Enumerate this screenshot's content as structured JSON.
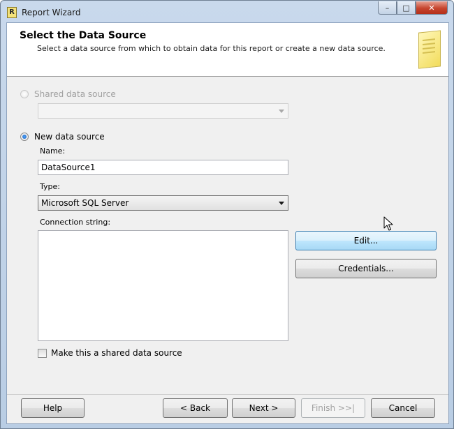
{
  "window": {
    "title": "Report Wizard",
    "app_icon_glyph": "R",
    "controls": {
      "minimize": "–",
      "maximize": "□",
      "close": "✕"
    }
  },
  "header": {
    "title": "Select the Data Source",
    "subtitle": "Select a data source from which to obtain data for this report or create a new data source."
  },
  "shared_source": {
    "label": "Shared data source",
    "selected": false,
    "enabled": false,
    "value": ""
  },
  "new_source": {
    "label": "New data source",
    "selected": true,
    "name_label": "Name:",
    "name_value": "DataSource1",
    "type_label": "Type:",
    "type_value": "Microsoft SQL Server",
    "conn_label": "Connection string:",
    "conn_value": ""
  },
  "actions": {
    "edit_label": "Edit...",
    "credentials_label": "Credentials..."
  },
  "shared_checkbox": {
    "label": "Make this a shared data source",
    "checked": false
  },
  "footer": {
    "help_label": "Help",
    "back_label": "< Back",
    "next_label": "Next >",
    "finish_label": "Finish >>|",
    "cancel_label": "Cancel"
  },
  "icons": {
    "app": "report-wizard-icon",
    "header_graphic": "document-icon",
    "cursor": "mouse-pointer-icon"
  }
}
